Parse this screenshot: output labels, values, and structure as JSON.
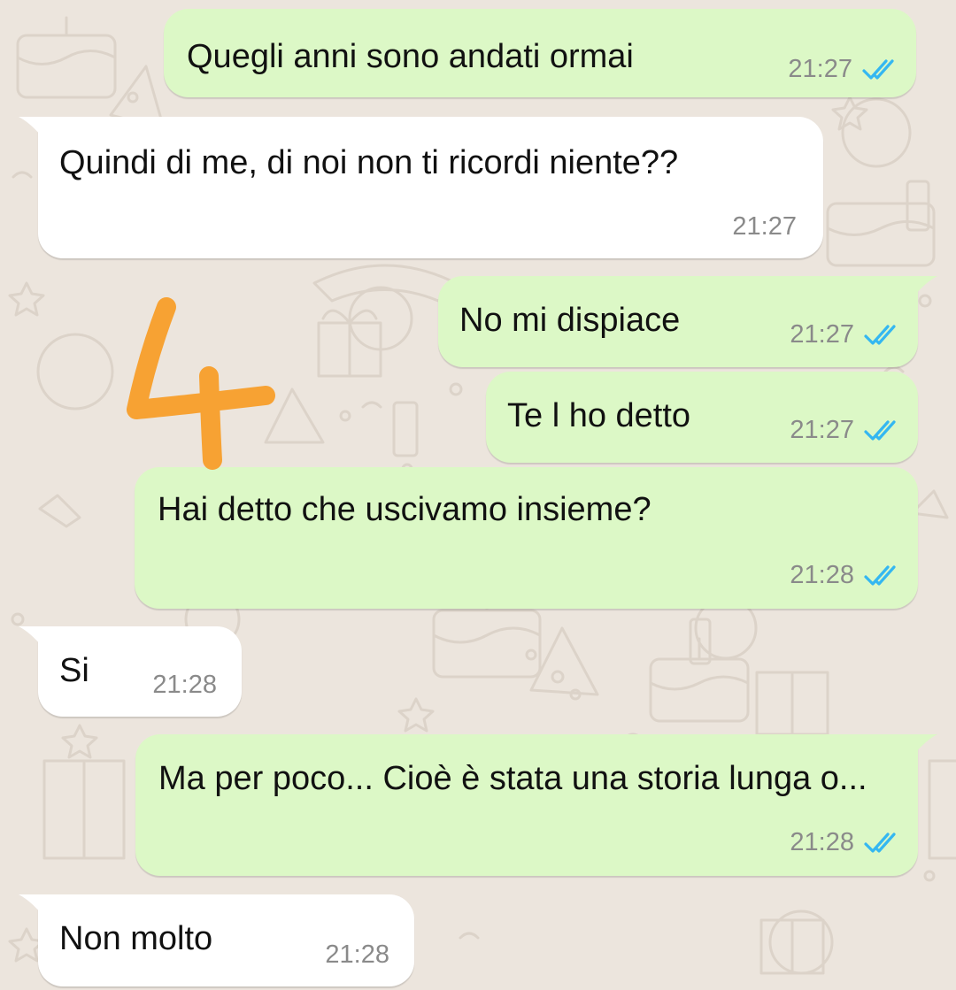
{
  "theme": {
    "wallpaper_color": "#ECE5DD",
    "outgoing_bubble_color": "#DCF8C6",
    "incoming_bubble_color": "#FFFFFF",
    "read_tick_color": "#34B7F1",
    "annotation_color": "#F7A233"
  },
  "annotation": {
    "label": "4"
  },
  "messages": [
    {
      "direction": "outgoing",
      "text": "Quegli anni sono andati ormai",
      "time": "21:27",
      "status": "read"
    },
    {
      "direction": "incoming",
      "text": "Quindi di me, di noi non ti ricordi niente??",
      "time": "21:27"
    },
    {
      "direction": "outgoing",
      "text": "No mi dispiace",
      "time": "21:27",
      "status": "read"
    },
    {
      "direction": "outgoing",
      "text": "Te l ho detto",
      "time": "21:27",
      "status": "read"
    },
    {
      "direction": "outgoing",
      "text": "Hai detto che uscivamo insieme?",
      "time": "21:28",
      "status": "read"
    },
    {
      "direction": "incoming",
      "text": "Si",
      "time": "21:28"
    },
    {
      "direction": "outgoing",
      "text": "Ma per poco... Cioè è stata una storia lunga o...",
      "time": "21:28",
      "status": "read"
    },
    {
      "direction": "incoming",
      "text": "Non molto",
      "time": "21:28"
    }
  ]
}
